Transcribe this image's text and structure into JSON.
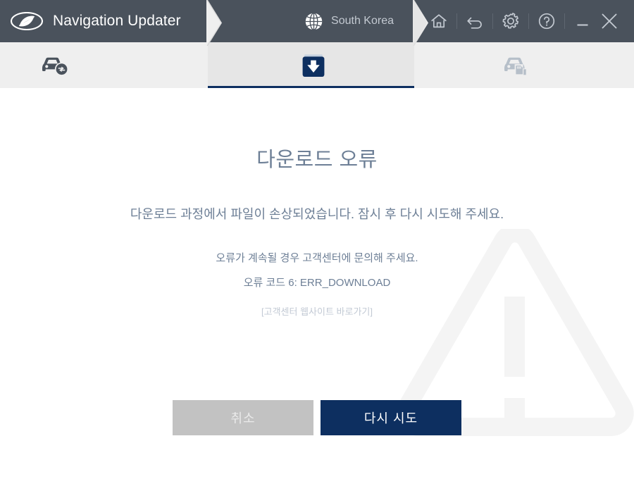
{
  "window": {
    "app_title": "Navigation Updater",
    "brand_icon": "hyundai-logo-icon"
  },
  "region": {
    "icon": "globe-icon",
    "name": "South Korea"
  },
  "window_actions": [
    {
      "name": "home-button",
      "icon": "home-icon",
      "label": "Home"
    },
    {
      "name": "back-button",
      "icon": "undo-arrow-icon",
      "label": "Back"
    },
    {
      "name": "settings-button",
      "icon": "gear-icon",
      "label": "Settings"
    },
    {
      "name": "help-button",
      "icon": "question-circle-icon",
      "label": "Help"
    },
    {
      "name": "minimize-button",
      "icon": "minimize-icon",
      "label": "Minimize"
    },
    {
      "name": "close-button",
      "icon": "close-x-icon",
      "label": "Close"
    }
  ],
  "steps": [
    {
      "name": "step-vehicle-check",
      "icon": "car-sync-icon",
      "state": "done"
    },
    {
      "name": "step-download",
      "icon": "download-box-icon",
      "state": "active"
    },
    {
      "name": "step-install-sd",
      "icon": "car-sdcard-icon",
      "state": "pending"
    }
  ],
  "main": {
    "watermark_icon": "warning-triangle-icon",
    "title": "다운로드 오류",
    "message": "다운로드 과정에서 파일이 손상되었습니다. 잠시 후 다시 시도해 주세요.",
    "sub_message": "오류가 계속될 경우 고객센터에 문의해 주세요.",
    "error_code": "오류 코드 6: ERR_DOWNLOAD",
    "support_link": "[고객센터 웹사이트 바로가기]"
  },
  "buttons": {
    "cancel": "취소",
    "retry": "다시 시도"
  },
  "colors": {
    "titlebar_bg": "#4a525c",
    "accent_navy": "#0d2f60",
    "step_bg": "#efefef",
    "step_active_bg": "#e6e6e6",
    "text_blue_gray": "#6d7f96",
    "cancel_gray": "#c2c2c2",
    "watermark_gray": "#f4f4f4"
  }
}
